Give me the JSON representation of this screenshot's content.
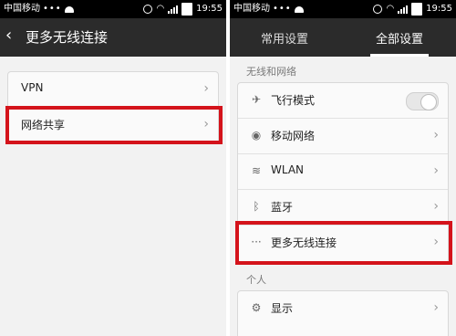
{
  "status": {
    "carrier": "中国移动",
    "dots": "•••",
    "time": "19:55"
  },
  "left": {
    "title": "更多无线连接",
    "back_icon": "chevron-left-icon",
    "items": [
      {
        "label": "VPN"
      },
      {
        "label": "网络共享"
      }
    ],
    "highlight_color": "#d4131b"
  },
  "right": {
    "tabs": [
      {
        "label": "常用设置",
        "active": false
      },
      {
        "label": "全部设置",
        "active": true
      }
    ],
    "section_wireless": "无线和网络",
    "items": [
      {
        "label": "飞行模式",
        "icon": "airplane-icon",
        "toggle": "off"
      },
      {
        "label": "移动网络",
        "icon": "signal-tower-icon"
      },
      {
        "label": "WLAN",
        "icon": "wifi-icon"
      },
      {
        "label": "蓝牙",
        "icon": "bluetooth-icon"
      },
      {
        "label": "更多无线连接",
        "icon": "more-dots-icon"
      }
    ],
    "section_personal": "个人",
    "personal_items": [
      {
        "label": "显示",
        "icon": "display-settings-icon"
      }
    ]
  }
}
